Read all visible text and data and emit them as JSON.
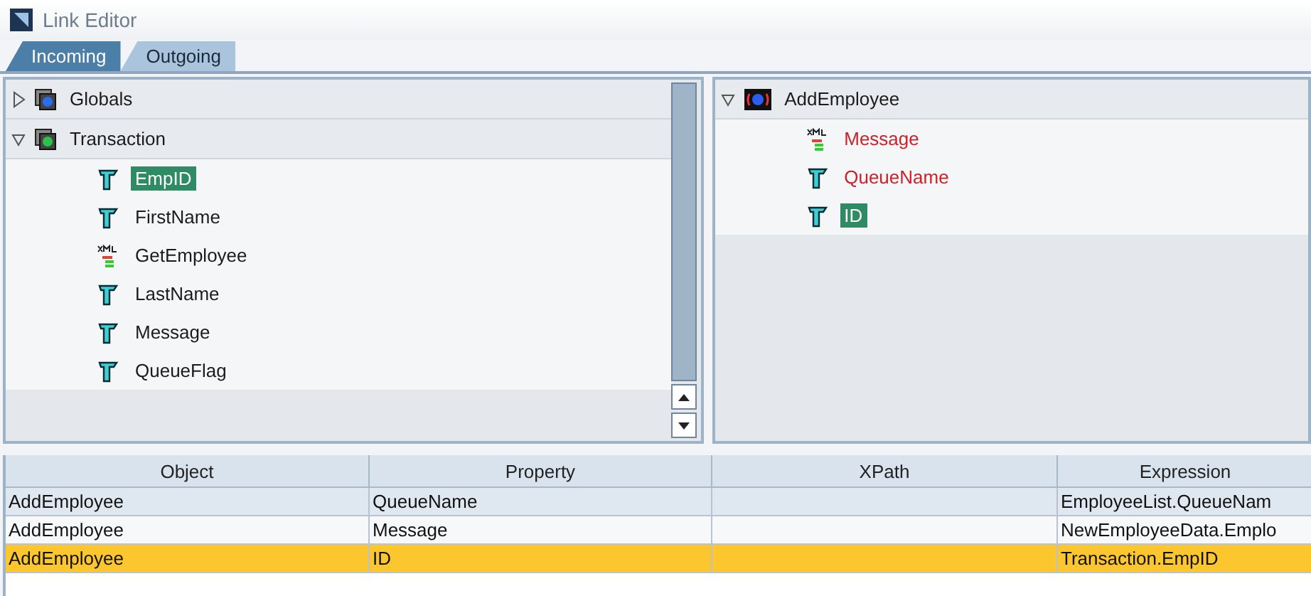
{
  "window": {
    "title": "Link Editor"
  },
  "tabs": [
    {
      "label": "Incoming",
      "selected": true
    },
    {
      "label": "Outgoing",
      "selected": false
    }
  ],
  "source_tree": [
    {
      "label": "Globals",
      "kind": "group-blue",
      "expanded": false
    },
    {
      "label": "Transaction",
      "kind": "group-green",
      "expanded": true,
      "children": [
        {
          "label": "EmpID",
          "kind": "field",
          "selected": true
        },
        {
          "label": "FirstName",
          "kind": "field",
          "selected": false
        },
        {
          "label": "GetEmployee",
          "kind": "xml",
          "selected": false
        },
        {
          "label": "LastName",
          "kind": "field",
          "selected": false
        },
        {
          "label": "Message",
          "kind": "field",
          "selected": false
        },
        {
          "label": "QueueFlag",
          "kind": "field",
          "selected": false
        }
      ]
    }
  ],
  "target_tree": [
    {
      "label": "AddEmployee",
      "kind": "service",
      "expanded": true,
      "children": [
        {
          "label": "Message",
          "kind": "xml",
          "selected": false,
          "unlinked": true
        },
        {
          "label": "QueueName",
          "kind": "field",
          "selected": false,
          "unlinked": true
        },
        {
          "label": "ID",
          "kind": "field",
          "selected": true,
          "unlinked": false
        }
      ]
    }
  ],
  "table": {
    "columns": [
      "Object",
      "Property",
      "XPath",
      "Expression"
    ],
    "rows": [
      {
        "cells": [
          "AddEmployee",
          "QueueName",
          "",
          "EmployeeList.QueueNam"
        ],
        "selected": false
      },
      {
        "cells": [
          "AddEmployee",
          "Message",
          "",
          "NewEmployeeData.Emplo"
        ],
        "selected": false
      },
      {
        "cells": [
          "AddEmployee",
          "ID",
          "",
          "Transaction.EmpID"
        ],
        "selected": true
      }
    ]
  }
}
